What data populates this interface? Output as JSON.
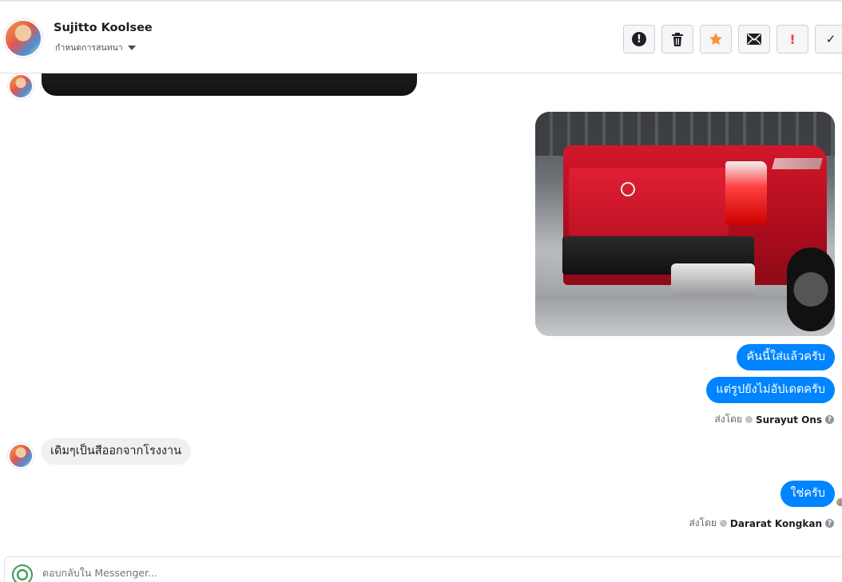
{
  "header": {
    "contact_name": "Sujitto Koolsee",
    "conversation_action": "กำหนดการสนทนา",
    "toolbar": [
      {
        "icon": "alert-circle-icon",
        "glyph": "!"
      },
      {
        "icon": "trash-icon",
        "glyph": ""
      },
      {
        "icon": "star-icon",
        "glyph": "★"
      },
      {
        "icon": "envelope-icon",
        "glyph": ""
      },
      {
        "icon": "exclamation-icon",
        "glyph": "!"
      },
      {
        "icon": "checkmark-icon",
        "glyph": "✓"
      }
    ]
  },
  "messages": {
    "outgoing_1": "คันนี้ใส่แล้วครับ",
    "outgoing_2": "แต่รูปยังไม่อัปเดตครับ",
    "sent_by_label_1": "ส่งโดย",
    "sent_by_name_1": "Surayut Ons",
    "incoming_1": "เดิมๆเป็นสีออกจากโรงงาน",
    "outgoing_3": "ใช่ครับ",
    "sent_by_label_2": "ส่งโดย",
    "sent_by_name_2": "Dararat Kongkan"
  },
  "composer": {
    "placeholder": "ตอบกลับใน Messenger..."
  },
  "colors": {
    "outgoing_bubble": "#0084ff",
    "incoming_bubble": "#f1f0f0",
    "star": "#f7923a",
    "exclamation": "#fa3e3e"
  }
}
